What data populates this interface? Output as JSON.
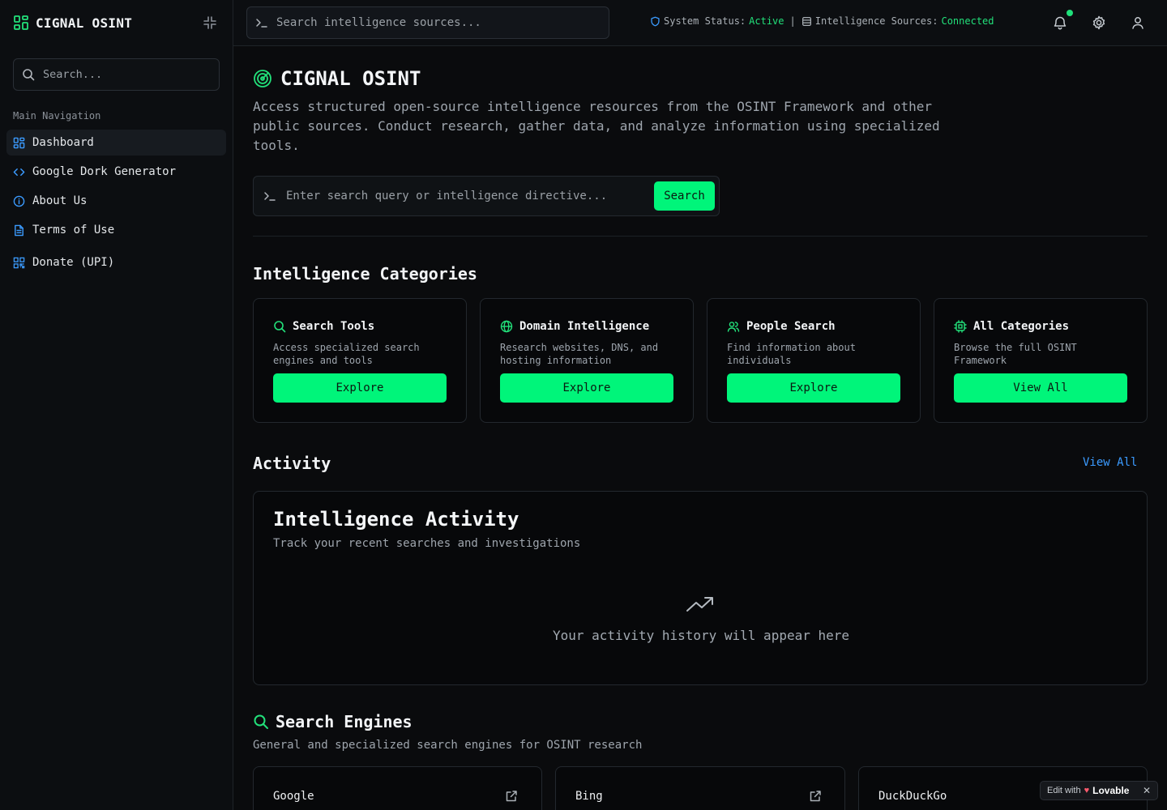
{
  "sidebar": {
    "brand": "CIGNAL OSINT",
    "search_placeholder": "Search...",
    "nav_title": "Main Navigation",
    "items": [
      {
        "label": "Dashboard",
        "icon": "grid-icon",
        "active": true
      },
      {
        "label": "Google Dork Generator",
        "icon": "code-icon"
      },
      {
        "label": "About Us",
        "icon": "info-icon"
      },
      {
        "label": "Terms of Use",
        "icon": "document-icon"
      },
      {
        "label": "Donate (UPI)",
        "icon": "qr-code-icon"
      }
    ]
  },
  "header": {
    "search_placeholder": "Search intelligence sources...",
    "system_status_label": "System Status:",
    "system_status_value": "Active",
    "separator": "|",
    "sources_label": "Intelligence Sources:",
    "sources_value": "Connected"
  },
  "hero": {
    "title": "CIGNAL OSINT",
    "description": "Access structured open-source intelligence resources from the OSINT Framework and other public sources. Conduct research, gather data, and analyze information using specialized tools.",
    "search_placeholder": "Enter search query or intelligence directive...",
    "search_button": "Search"
  },
  "categories": {
    "title": "Intelligence Categories",
    "items": [
      {
        "title": "Search Tools",
        "desc": "Access specialized search engines and tools",
        "button": "Explore",
        "icon": "search-icon"
      },
      {
        "title": "Domain Intelligence",
        "desc": "Research websites, DNS, and hosting information",
        "button": "Explore",
        "icon": "globe-icon"
      },
      {
        "title": "People Search",
        "desc": "Find information about individuals",
        "button": "Explore",
        "icon": "users-icon"
      },
      {
        "title": "All Categories",
        "desc": "Browse the full OSINT Framework",
        "button": "View All",
        "icon": "cpu-icon"
      }
    ]
  },
  "activity": {
    "title": "Activity",
    "view_all": "View All",
    "card_title": "Intelligence Activity",
    "card_subtitle": "Track your recent searches and investigations",
    "empty": "Your activity history will appear here"
  },
  "engines": {
    "title": "Search Engines",
    "subtitle": "General and specialized search engines for OSINT research",
    "items": [
      "Google",
      "Bing",
      "DuckDuckGo"
    ]
  },
  "badge": {
    "prefix": "Edit with",
    "brand": "Lovable",
    "close": "✕"
  },
  "colors": {
    "accent": "#00f57a",
    "link": "#3b9bff",
    "background": "#0a0b0d"
  }
}
